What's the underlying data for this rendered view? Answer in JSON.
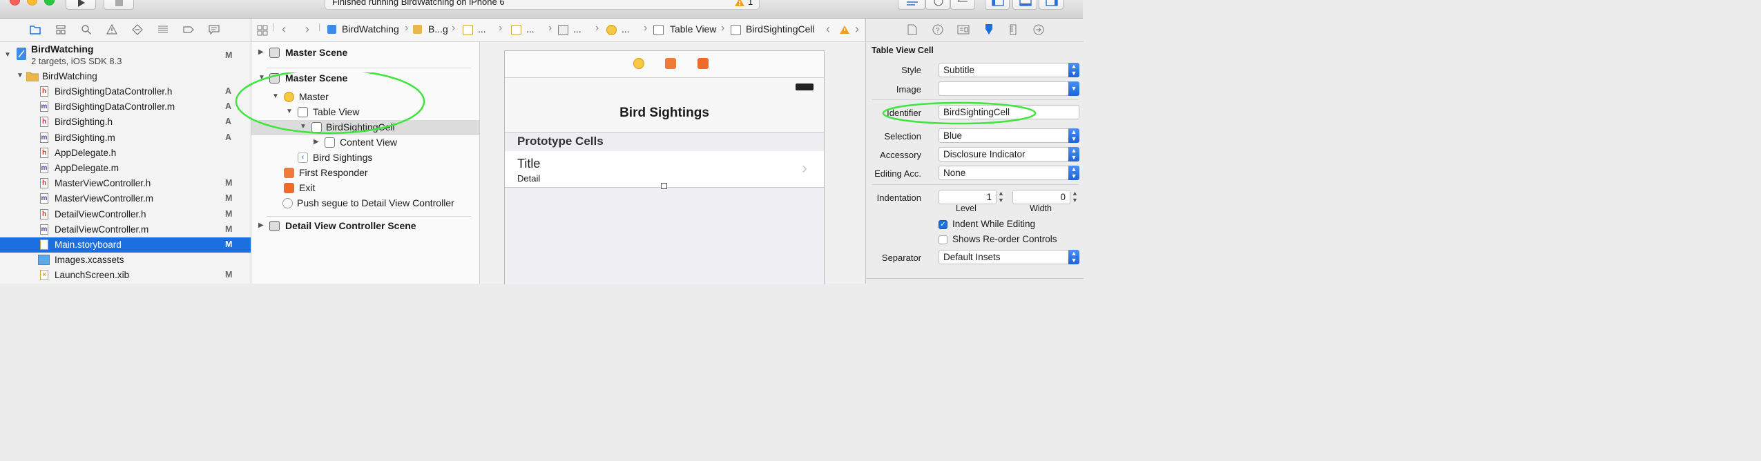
{
  "toolbar": {
    "status_text": "Finished running BirdWatching on iPhone 6",
    "warning_count": "1"
  },
  "navigator": {
    "project": {
      "name": "BirdWatching",
      "subtitle": "2 targets, iOS SDK 8.3",
      "badge": "M"
    },
    "group": {
      "name": "BirdWatching"
    },
    "files": [
      {
        "name": "BirdSightingDataController.h",
        "type": "h",
        "badge": "A"
      },
      {
        "name": "BirdSightingDataController.m",
        "type": "m",
        "badge": "A"
      },
      {
        "name": "BirdSighting.h",
        "type": "h",
        "badge": "A"
      },
      {
        "name": "BirdSighting.m",
        "type": "m",
        "badge": "A"
      },
      {
        "name": "AppDelegate.h",
        "type": "h",
        "badge": ""
      },
      {
        "name": "AppDelegate.m",
        "type": "m",
        "badge": ""
      },
      {
        "name": "MasterViewController.h",
        "type": "h",
        "badge": "M"
      },
      {
        "name": "MasterViewController.m",
        "type": "m",
        "badge": "M"
      },
      {
        "name": "DetailViewController.h",
        "type": "h",
        "badge": "M"
      },
      {
        "name": "DetailViewController.m",
        "type": "m",
        "badge": "M"
      },
      {
        "name": "Main.storyboard",
        "type": "storyboard",
        "badge": "M"
      },
      {
        "name": "Images.xcassets",
        "type": "folder",
        "badge": ""
      },
      {
        "name": "LaunchScreen.xib",
        "type": "xib",
        "badge": "M"
      }
    ]
  },
  "jumpbar": {
    "items": [
      "BirdWatching",
      "B...g",
      "...",
      "...",
      "...",
      "...",
      "Table View",
      "BirdSightingCell"
    ]
  },
  "outline": {
    "scene1": "Master Scene",
    "scene2": "Master Scene",
    "master": "Master",
    "table_view": "Table View",
    "cell": "BirdSightingCell",
    "content_view": "Content View",
    "bird_sightings": "Bird Sightings",
    "first_responder": "First Responder",
    "exit": "Exit",
    "segue": "Push segue to Detail View Controller",
    "scene3": "Detail View Controller Scene"
  },
  "canvas": {
    "nav_title": "Bird Sightings",
    "section_header": "Prototype Cells",
    "cell_title": "Title",
    "cell_detail": "Detail"
  },
  "inspector": {
    "section": "Table View Cell",
    "style_label": "Style",
    "style_value": "Subtitle",
    "image_label": "Image",
    "image_value": "",
    "identifier_label": "Identifier",
    "identifier_value": "BirdSightingCell",
    "selection_label": "Selection",
    "selection_value": "Blue",
    "accessory_label": "Accessory",
    "accessory_value": "Disclosure Indicator",
    "editing_label": "Editing Acc.",
    "editing_value": "None",
    "indentation_label": "Indentation",
    "level_value": "1",
    "width_value": "0",
    "level_caption": "Level",
    "width_caption": "Width",
    "indent_while_editing": "Indent While Editing",
    "indent_while_editing_checked": true,
    "shows_reorder": "Shows Re-order Controls",
    "shows_reorder_checked": false,
    "separator_label": "Separator",
    "separator_value": "Default Insets"
  },
  "colors": {
    "selection": "#1b6fe0",
    "highlight_ellipse": "#3de63d",
    "accent_orange": "#f0a020"
  }
}
